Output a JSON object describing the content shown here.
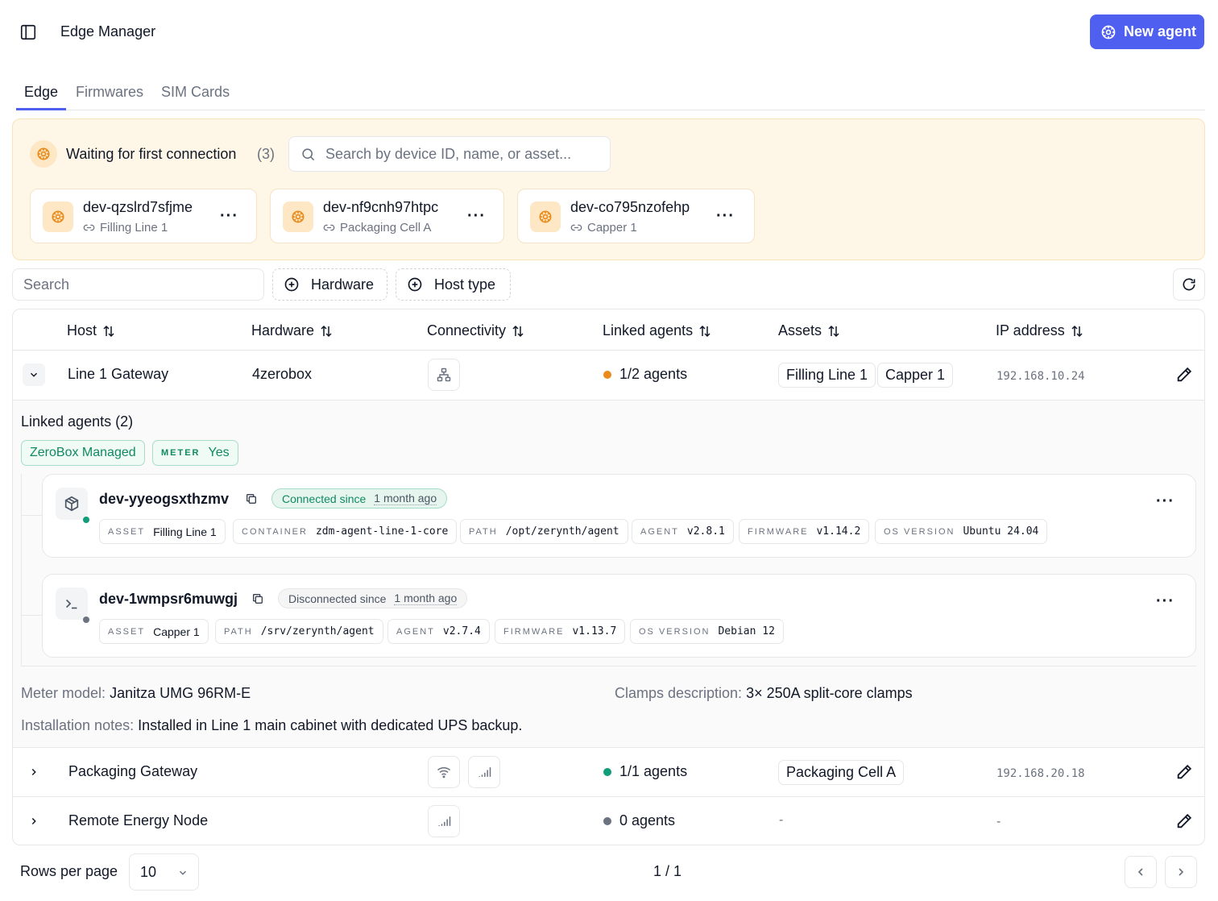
{
  "header": {
    "title": "Edge Manager",
    "new_agent_label": "New agent"
  },
  "tabs": [
    {
      "label": "Edge",
      "active": true
    },
    {
      "label": "Firmwares",
      "active": false
    },
    {
      "label": "SIM Cards",
      "active": false
    }
  ],
  "waiting": {
    "title": "Waiting for first connection",
    "count": "(3)",
    "search_placeholder": "Search by device ID, name, or asset...",
    "devices": [
      {
        "id": "dev-qzslrd7sfjme",
        "asset": "Filling Line 1"
      },
      {
        "id": "dev-nf9cnh97htpc",
        "asset": "Packaging Cell A"
      },
      {
        "id": "dev-co795nzofehp",
        "asset": "Capper 1"
      }
    ]
  },
  "filters": {
    "search_placeholder": "Search",
    "hardware_label": "Hardware",
    "host_type_label": "Host type"
  },
  "table": {
    "columns": [
      "Host",
      "Hardware",
      "Connectivity",
      "Linked agents",
      "Assets",
      "IP address"
    ],
    "rows": [
      {
        "host": "Line 1 Gateway",
        "hardware": "4zerobox",
        "linked_agents": "1/2 agents",
        "assets": [
          "Filling Line 1",
          "Capper 1"
        ],
        "ip": "192.168.10.24",
        "expanded": true
      },
      {
        "host": "Packaging Gateway",
        "hardware": "",
        "linked_agents": "1/1 agents",
        "assets": [
          "Packaging Cell A"
        ],
        "ip": "192.168.20.18",
        "expanded": false
      },
      {
        "host": "Remote Energy Node",
        "hardware": "",
        "linked_agents": "0 agents",
        "assets_empty": "-",
        "ip_empty": "-",
        "expanded": false
      }
    ]
  },
  "expanded": {
    "title": "Linked agents (2)",
    "tag_managed": "ZeroBox Managed",
    "tag_meter_key": "METER",
    "tag_meter_val": "Yes",
    "agents": [
      {
        "id": "dev-yyeogsxthzmv",
        "status_prefix": "Connected since",
        "status_ago": "1 month ago",
        "meta": [
          {
            "k": "ASSET",
            "v": "Filling Line 1"
          },
          {
            "k": "CONTAINER",
            "v": "zdm-agent-line-1-core"
          },
          {
            "k": "PATH",
            "v": "/opt/zerynth/agent"
          },
          {
            "k": "AGENT",
            "v": "v2.8.1"
          },
          {
            "k": "FIRMWARE",
            "v": "v1.14.2"
          },
          {
            "k": "OS VERSION",
            "v": "Ubuntu 24.04"
          }
        ]
      },
      {
        "id": "dev-1wmpsr6muwgj",
        "status_prefix": "Disconnected since",
        "status_ago": "1 month ago",
        "meta": [
          {
            "k": "ASSET",
            "v": "Capper 1"
          },
          {
            "k": "PATH",
            "v": "/srv/zerynth/agent"
          },
          {
            "k": "AGENT",
            "v": "v2.7.4"
          },
          {
            "k": "FIRMWARE",
            "v": "v1.13.7"
          },
          {
            "k": "OS VERSION",
            "v": "Debian 12"
          }
        ]
      }
    ],
    "meter_model_key": "Meter model:",
    "meter_model_val": "Janitza UMG 96RM-E",
    "clamps_key": "Clamps description:",
    "clamps_val": "3× 250A split-core clamps",
    "notes_key": "Installation notes:",
    "notes_val": "Installed in Line 1 main cabinet with dedicated UPS backup."
  },
  "footer": {
    "rows_label": "Rows per page",
    "rows_value": "10",
    "page_text": "1 / 1"
  },
  "colors": {
    "accent": "#4f5ff0",
    "waiting_bg": "#fef6e7",
    "orange": "#ea8a1a",
    "green": "#0f9d7a",
    "gray_dot": "#6b7280"
  }
}
